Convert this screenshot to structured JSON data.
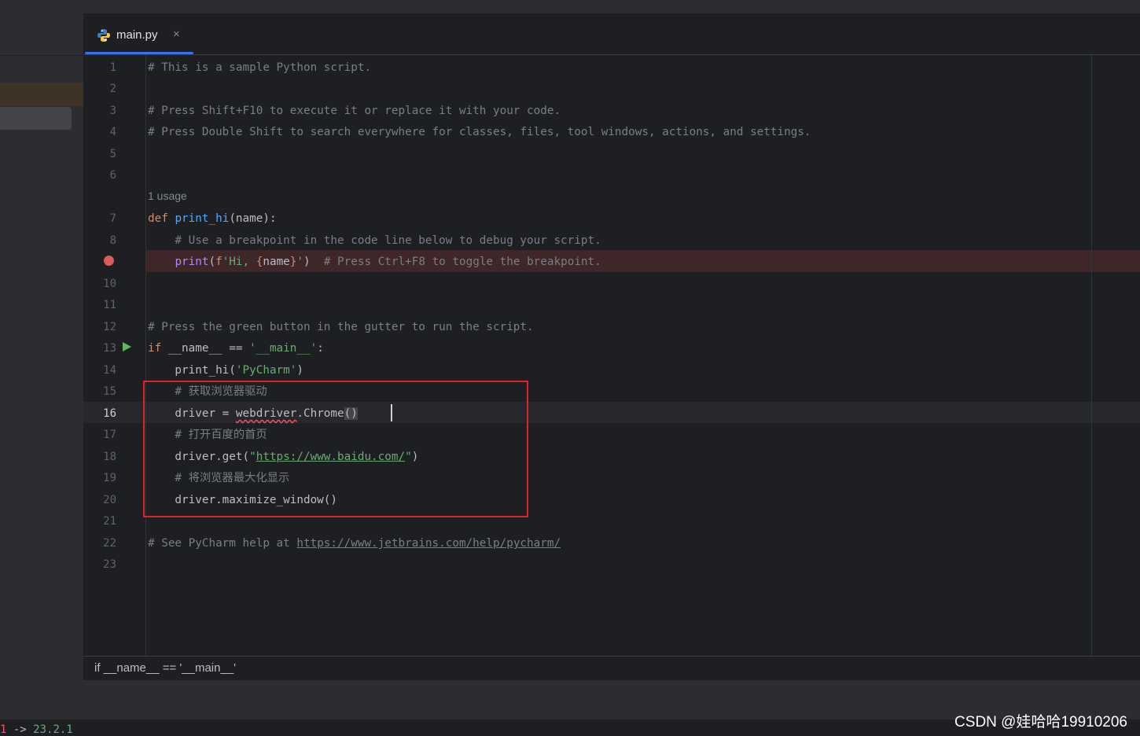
{
  "tab": {
    "icon": "python-file-icon",
    "label": "main.py",
    "close": "×"
  },
  "editor": {
    "lines": [
      {
        "num": "1",
        "code": "# This is a sample Python script."
      },
      {
        "num": "2",
        "code": ""
      },
      {
        "num": "3",
        "code": "# Press Shift+F10 to execute it or replace it with your code."
      },
      {
        "num": "4",
        "code": "# Press Double Shift to search everywhere for classes, files, tool windows, actions, and settings."
      },
      {
        "num": "5",
        "code": ""
      },
      {
        "num": "6",
        "code": ""
      },
      {
        "num": "7",
        "code": "def print_hi(name):"
      },
      {
        "num": "8",
        "code": "    # Use a breakpoint in the code line below to debug your script."
      },
      {
        "num": "",
        "code": "    print(f'Hi, {name}')  # Press Ctrl+F8 to toggle the breakpoint."
      },
      {
        "num": "10",
        "code": ""
      },
      {
        "num": "11",
        "code": ""
      },
      {
        "num": "12",
        "code": "# Press the green button in the gutter to run the script."
      },
      {
        "num": "13",
        "code": "if __name__ == '__main__':"
      },
      {
        "num": "14",
        "code": "    print_hi('PyCharm')"
      },
      {
        "num": "15",
        "code": "    # 获取浏览器驱动"
      },
      {
        "num": "16",
        "code": "    driver = webdriver.Chrome()"
      },
      {
        "num": "17",
        "code": "    # 打开百度的首页"
      },
      {
        "num": "18",
        "code": "    driver.get(\"https://www.baidu.com/\")"
      },
      {
        "num": "19",
        "code": "    # 将浏览器最大化显示"
      },
      {
        "num": "20",
        "code": "    driver.maximize_window()"
      },
      {
        "num": "21",
        "code": ""
      },
      {
        "num": "22",
        "code": "# See PyCharm help at https://www.jetbrains.com/help/pycharm/"
      },
      {
        "num": "23",
        "code": ""
      }
    ],
    "inlay_hint": "1 usage"
  },
  "breadcrumb": "if __name__ == '__main__'",
  "status": {
    "red": "1",
    "arrow": " -> ",
    "version": "23.2.1"
  },
  "watermark": "CSDN @娃哈哈19910206",
  "colors": {
    "background": "#1e1f22",
    "panel": "#2b2d30",
    "accent": "#3574f0",
    "comment": "#7a7e85",
    "keyword": "#cf8e6d",
    "function": "#56a8f5",
    "string": "#6aab73",
    "breakpoint": "#db5c5c",
    "annotation_box": "#e0232b"
  }
}
